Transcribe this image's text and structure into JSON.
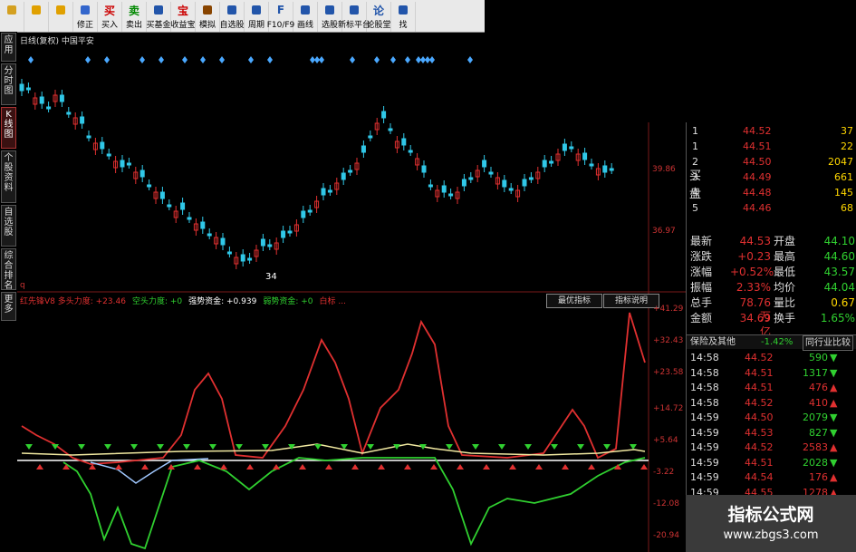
{
  "toolbar": {
    "buttons": [
      {
        "label": "",
        "icon": "grid-icon",
        "color": "#d4a020"
      },
      {
        "label": "",
        "icon": "back-arrow-icon",
        "color": "#e0a000"
      },
      {
        "label": "",
        "icon": "up-arrow-icon",
        "color": "#e0a000"
      },
      {
        "label": "修正",
        "icon": "edit-icon",
        "color": "#3366cc"
      },
      {
        "label": "买入",
        "icon": "buy-icon",
        "glyph": "买",
        "color": "#cc0000"
      },
      {
        "label": "卖出",
        "icon": "sell-icon",
        "glyph": "卖",
        "color": "#008800"
      },
      {
        "label": "买基金",
        "icon": "fund-icon",
        "color": "#2255aa"
      },
      {
        "label": "收益宝",
        "icon": "moneybag-icon",
        "glyph": "宝",
        "color": "#cc0000"
      },
      {
        "label": "模拟",
        "icon": "hammer-icon",
        "color": "#884400"
      },
      {
        "label": "自选股",
        "icon": "star-icon",
        "color": "#2255aa"
      },
      {
        "label": "周期",
        "icon": "clock-icon",
        "color": "#2255aa"
      },
      {
        "label": "F10/F9",
        "icon": "f10-icon",
        "glyph": "F",
        "color": "#2255aa"
      },
      {
        "label": "画线",
        "icon": "drawline-icon",
        "color": "#2255aa"
      },
      {
        "label": "选股",
        "icon": "select-stock-icon",
        "color": "#2255aa"
      },
      {
        "label": "新标平台",
        "icon": "platform-icon",
        "color": "#2255aa"
      },
      {
        "label": "论股堂",
        "icon": "discussion-icon",
        "glyph": "论",
        "color": "#2255aa"
      },
      {
        "label": "找",
        "icon": "find-icon",
        "color": "#2255aa"
      }
    ]
  },
  "sidebar": {
    "tabs": [
      "应用",
      "分时图",
      "K线图",
      "个股资料",
      "自选股",
      "综合排名",
      "更多"
    ]
  },
  "chart": {
    "title": "日线(复权) 中国平安",
    "price_labels": [
      "39.86",
      "36.97"
    ],
    "low_marker": "34",
    "bottom_q": "q"
  },
  "indicator": {
    "legend": [
      {
        "text": "红先锋V8 多头力度: +23.46",
        "color": "#e03030"
      },
      {
        "text": "空头力度: +0",
        "color": "#30d030"
      },
      {
        "text": "强势资金: +0.939",
        "color": "#ffffff"
      },
      {
        "text": "弱势资金: +0",
        "color": "#30d030"
      },
      {
        "text": "白标 ...",
        "color": "#e03030"
      }
    ],
    "buttons": [
      "最优指标",
      "指标说明"
    ],
    "y_labels": [
      "+41.29",
      "+32.43",
      "+23.58",
      "+14.72",
      "+5.64",
      "-3.22",
      "-12.08",
      "-20.94"
    ]
  },
  "quote": {
    "buy_label": "买盘",
    "buy": [
      {
        "n": "1",
        "price": "44.52",
        "vol": "37"
      },
      {
        "n": "1",
        "price": "44.51",
        "vol": "22"
      },
      {
        "n": "2",
        "price": "44.50",
        "vol": "2047"
      },
      {
        "n": "3",
        "price": "44.49",
        "vol": "661"
      },
      {
        "n": "4",
        "price": "44.48",
        "vol": "145"
      },
      {
        "n": "5",
        "price": "44.46",
        "vol": "68"
      }
    ],
    "stats": [
      {
        "l1": "最新",
        "v1": "44.53",
        "l2": "开盘",
        "v2": "44.10"
      },
      {
        "l1": "涨跌",
        "v1": "+0.23",
        "l2": "最高",
        "v2": "44.60"
      },
      {
        "l1": "涨幅",
        "v1": "+0.52%",
        "l2": "最低",
        "v2": "43.57"
      },
      {
        "l1": "振幅",
        "v1": "2.33%",
        "l2": "均价",
        "v2": "44.04"
      },
      {
        "l1": "总手",
        "v1": "78.76万",
        "l2": "量比",
        "v2": "0.67"
      },
      {
        "l1": "金额",
        "v1": "34.69亿",
        "l2": "换手",
        "v2": "1.65%"
      }
    ],
    "sector": {
      "name": "保险及其他",
      "change": "-1.42%",
      "compare": "同行业比较"
    },
    "ticks": [
      {
        "time": "14:58",
        "price": "44.52",
        "vol": "590",
        "dir": "down"
      },
      {
        "time": "14:58",
        "price": "44.51",
        "vol": "1317",
        "dir": "down"
      },
      {
        "time": "14:58",
        "price": "44.51",
        "vol": "476",
        "dir": "up"
      },
      {
        "time": "14:58",
        "price": "44.52",
        "vol": "410",
        "dir": "up"
      },
      {
        "time": "14:59",
        "price": "44.50",
        "vol": "2079",
        "dir": "down"
      },
      {
        "time": "14:59",
        "price": "44.53",
        "vol": "827",
        "dir": "down"
      },
      {
        "time": "14:59",
        "price": "44.52",
        "vol": "2583",
        "dir": "up"
      },
      {
        "time": "14:59",
        "price": "44.51",
        "vol": "2028",
        "dir": "down"
      },
      {
        "time": "14:59",
        "price": "44.54",
        "vol": "176",
        "dir": "up"
      },
      {
        "time": "14:59",
        "price": "44.55",
        "vol": "1278",
        "dir": "up"
      }
    ]
  },
  "watermark": {
    "title": "指标公式网",
    "url": "www.zbgs3.com"
  },
  "colors": {
    "up": "#e03030",
    "down": "#30d030",
    "cyan": "#30c8e8",
    "yellow": "#ffd700",
    "white": "#ffffff",
    "diamond": "#4aa8ff"
  }
}
